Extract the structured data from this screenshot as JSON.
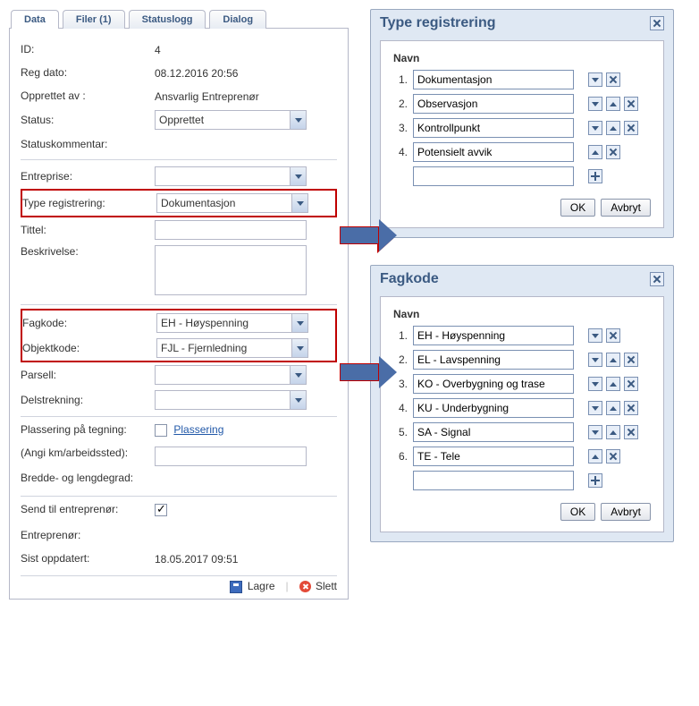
{
  "tabs": {
    "items": [
      {
        "label": "Data",
        "active": true
      },
      {
        "label": "Filer (1)",
        "active": false
      },
      {
        "label": "Statuslogg",
        "active": false
      },
      {
        "label": "Dialog",
        "active": false
      }
    ]
  },
  "form": {
    "id_label": "ID:",
    "id_value": "4",
    "regdato_label": "Reg dato:",
    "regdato_value": "08.12.2016 20:56",
    "opprettet_av_label": "Opprettet av :",
    "opprettet_av_value": "Ansvarlig Entreprenør",
    "status_label": "Status:",
    "status_value": "Opprettet",
    "statuskommentar_label": "Statuskommentar:",
    "entreprise_label": "Entreprise:",
    "entreprise_value": "",
    "typereg_label": "Type registrering:",
    "typereg_value": "Dokumentasjon",
    "tittel_label": "Tittel:",
    "tittel_value": "",
    "beskrivelse_label": "Beskrivelse:",
    "beskrivelse_value": "",
    "fagkode_label": "Fagkode:",
    "fagkode_value": "EH - Høyspenning",
    "objektkode_label": "Objektkode:",
    "objektkode_value": "FJL - Fjernledning",
    "parsell_label": "Parsell:",
    "parsell_value": "",
    "delstrekning_label": "Delstrekning:",
    "delstrekning_value": "",
    "plassering_label": "Plassering på tegning:",
    "plassering_link": "Plassering",
    "angi_km_label": "(Angi km/arbeidssted):",
    "angi_km_value": "",
    "bredde_label": "Bredde- og lengdegrad:",
    "send_til_label": "Send til entreprenør:",
    "send_til_checked": true,
    "entreprenor_label": "Entreprenør:",
    "sist_oppdatert_label": "Sist oppdatert:",
    "sist_oppdatert_value": "18.05.2017 09:51"
  },
  "toolbar": {
    "save_label": "Lagre",
    "delete_label": "Slett"
  },
  "dialog_typereg": {
    "title": "Type registrering",
    "navn_label": "Navn",
    "items": [
      {
        "n": "1.",
        "value": "Dokumentasjon",
        "down": true,
        "up": false,
        "del": true
      },
      {
        "n": "2.",
        "value": "Observasjon",
        "down": true,
        "up": true,
        "del": true
      },
      {
        "n": "3.",
        "value": "Kontrollpunkt",
        "down": true,
        "up": true,
        "del": true
      },
      {
        "n": "4.",
        "value": "Potensielt avvik",
        "down": false,
        "up": true,
        "del": true
      }
    ],
    "ok_label": "OK",
    "cancel_label": "Avbryt"
  },
  "dialog_fagkode": {
    "title": "Fagkode",
    "navn_label": "Navn",
    "items": [
      {
        "n": "1.",
        "value": "EH - Høyspenning",
        "down": true,
        "up": false,
        "del": true
      },
      {
        "n": "2.",
        "value": "EL - Lavspenning",
        "down": true,
        "up": true,
        "del": true
      },
      {
        "n": "3.",
        "value": "KO - Overbygning og trase",
        "down": true,
        "up": true,
        "del": true
      },
      {
        "n": "4.",
        "value": "KU - Underbygning",
        "down": true,
        "up": true,
        "del": true
      },
      {
        "n": "5.",
        "value": "SA - Signal",
        "down": true,
        "up": true,
        "del": true
      },
      {
        "n": "6.",
        "value": "TE - Tele",
        "down": false,
        "up": true,
        "del": true
      }
    ],
    "ok_label": "OK",
    "cancel_label": "Avbryt"
  }
}
